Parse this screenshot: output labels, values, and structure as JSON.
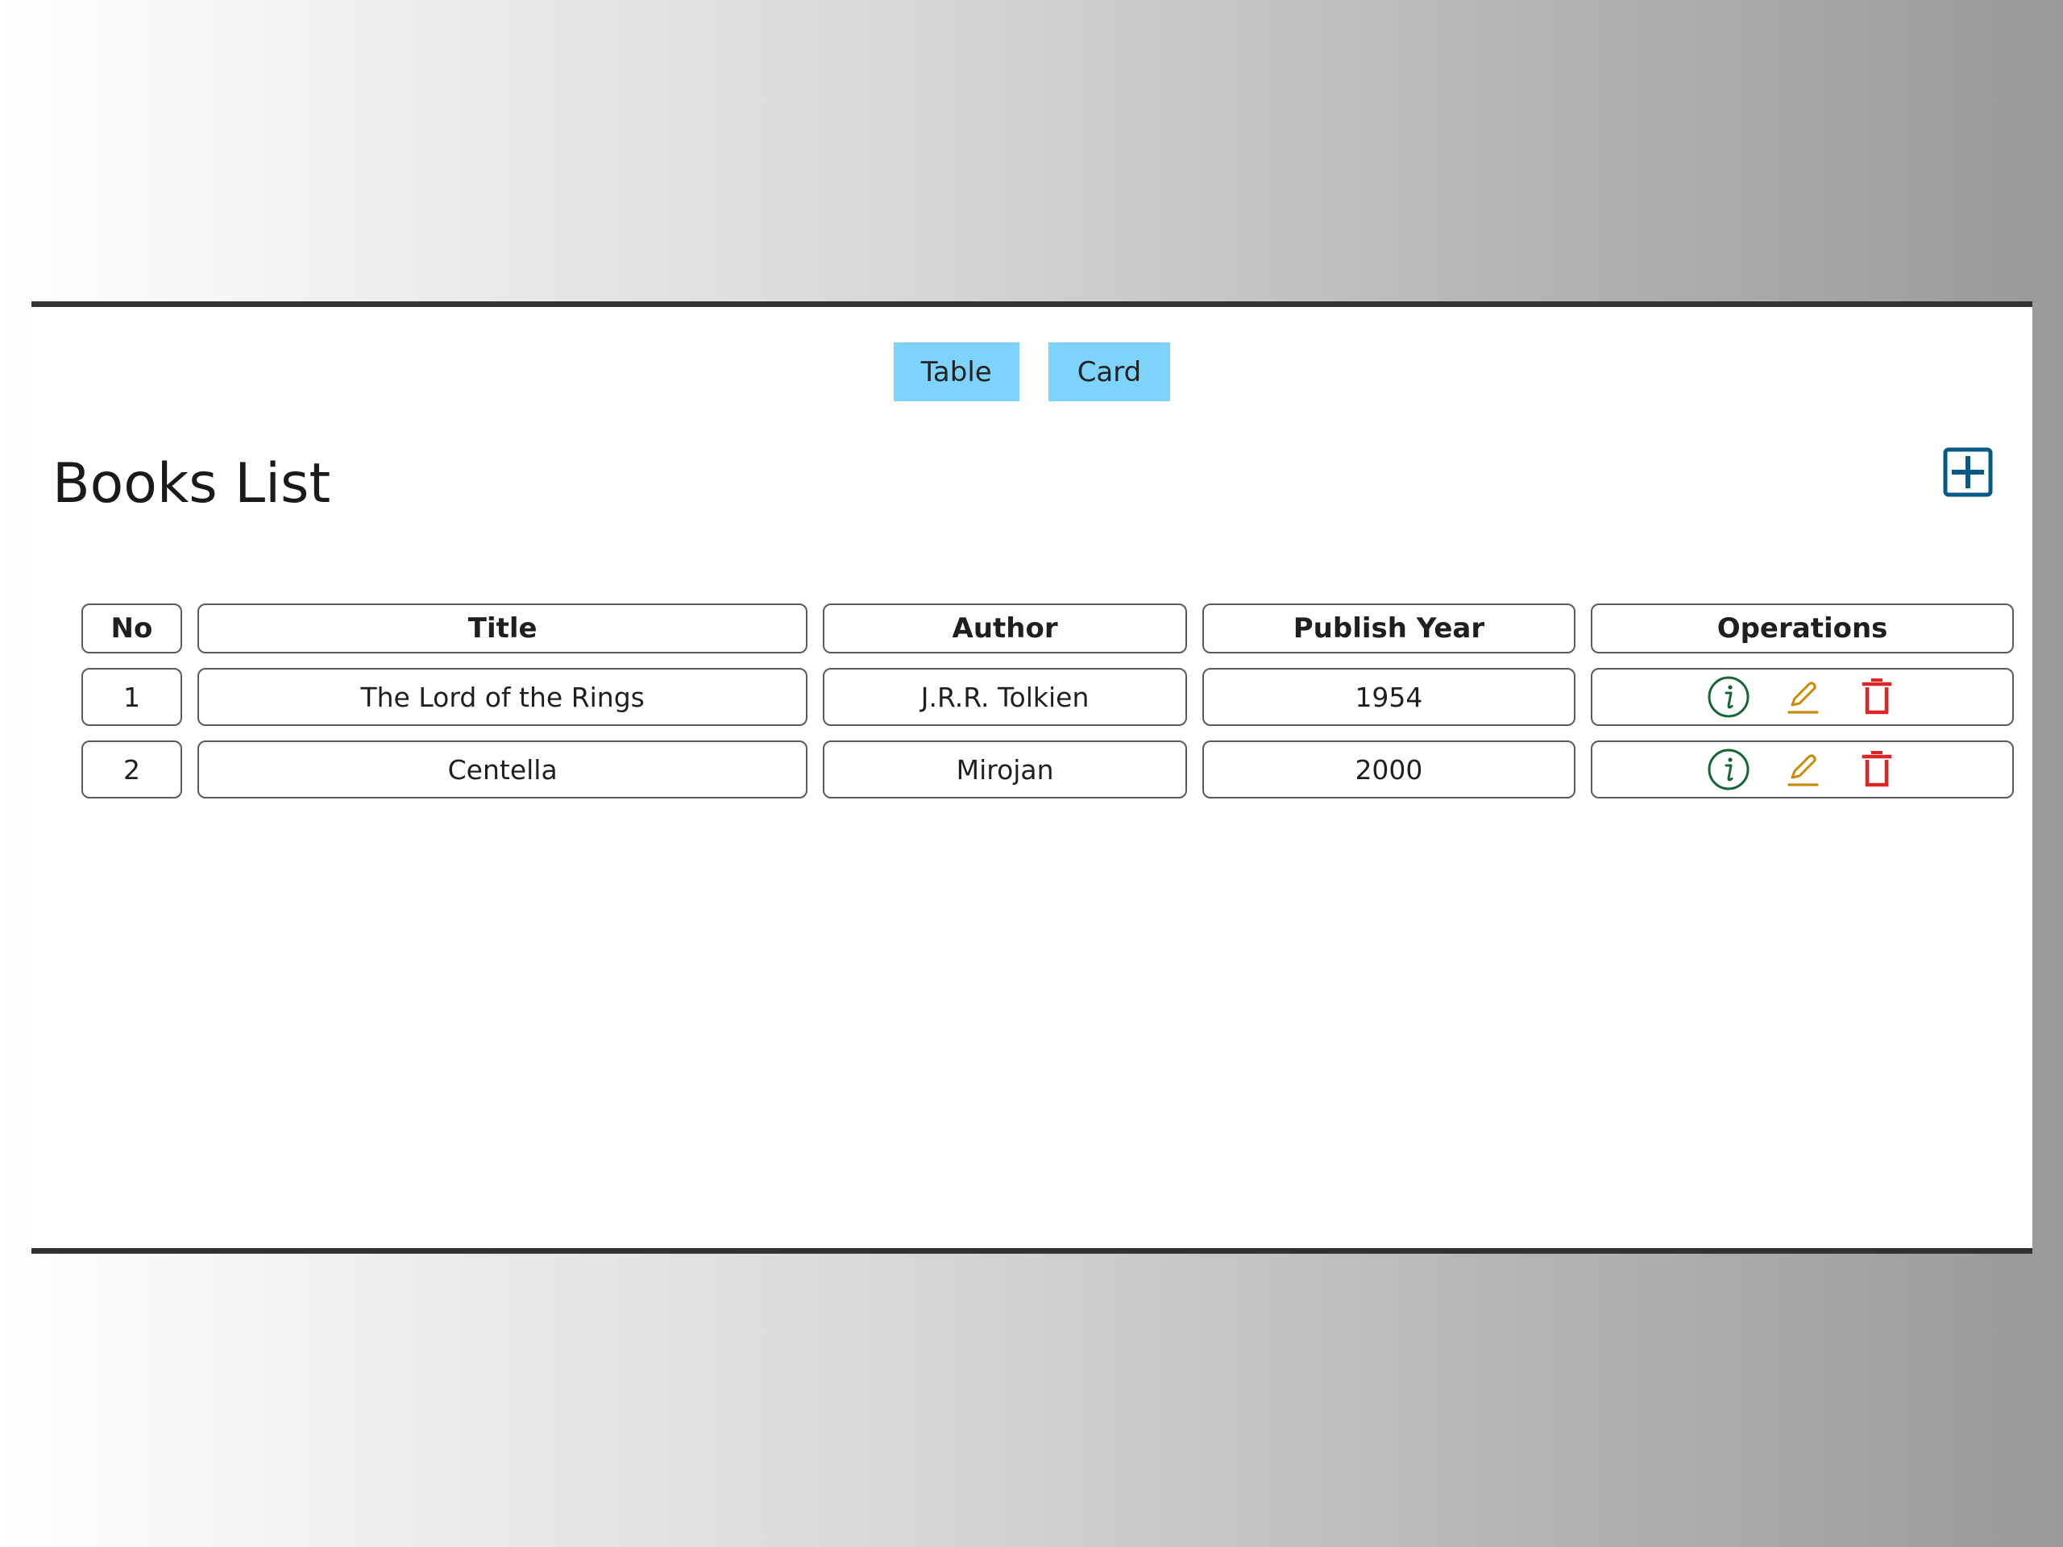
{
  "view_toggle": {
    "table_label": "Table",
    "card_label": "Card"
  },
  "header": {
    "title": "Books List",
    "add_icon": "plus-square-icon"
  },
  "table": {
    "columns": [
      "No",
      "Title",
      "Author",
      "Publish Year",
      "Operations"
    ],
    "rows": [
      {
        "no": "1",
        "title": "The Lord of the Rings",
        "author": "J.R.R. Tolkien",
        "publish_year": "1954"
      },
      {
        "no": "2",
        "title": "Centella",
        "author": "Mirojan",
        "publish_year": "2000"
      }
    ],
    "operation_icons": [
      "info-circle-icon",
      "edit-pencil-icon",
      "trash-icon"
    ]
  },
  "colors": {
    "toggle_bg": "#7dd3fc",
    "add_icon": "#075985",
    "info_icon": "#166534",
    "edit_icon": "#ca8a04",
    "delete_icon": "#dc2626",
    "frame_border": "#333333"
  }
}
